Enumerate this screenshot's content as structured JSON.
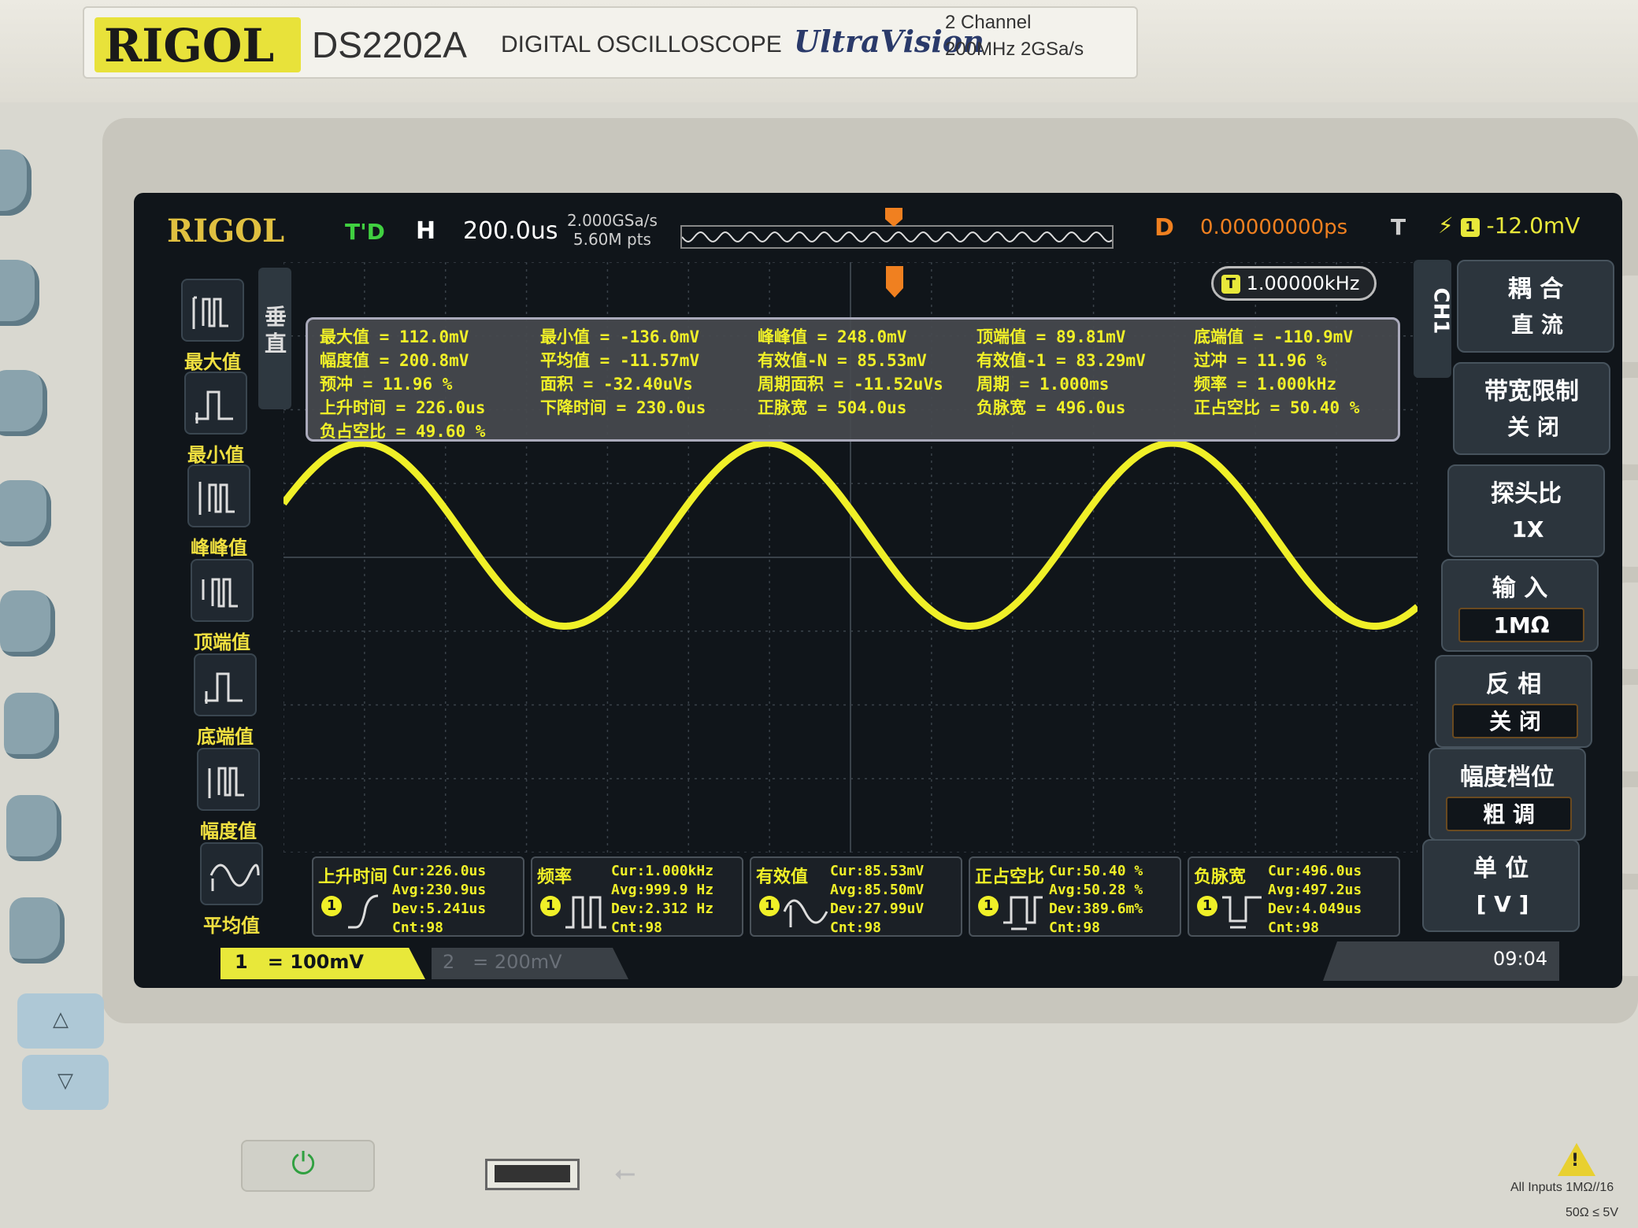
{
  "device": {
    "brand": "RIGOL",
    "model": "DS2202A",
    "description": "DIGITAL OSCILLOSCOPE",
    "series": "UltraVision",
    "channels": "2 Channel",
    "spec": "200MHz  2GSa/s"
  },
  "topbar": {
    "logo": "RIGOL",
    "mode": "T'D",
    "h_label": "H",
    "timebase": "200.0us",
    "sample_rate": "2.000GSa/s",
    "memory": "5.60M pts",
    "d_label": "D",
    "delay": "0.00000000ps",
    "t_label": "T",
    "trigger_source": "1",
    "trigger_level": "-12.0mV",
    "colors": {
      "delay": "#f08020",
      "trigger": "#e8e83a",
      "mode": "#40d040"
    }
  },
  "freq_counter": {
    "value": "1.00000kHz",
    "badge": "T"
  },
  "measurements": [
    {
      "label": "最大值",
      "value": "= 112.0mV"
    },
    {
      "label": "最小值",
      "value": "= -136.0mV"
    },
    {
      "label": "峰峰值",
      "value": "= 248.0mV"
    },
    {
      "label": "顶端值",
      "value": "= 89.81mV"
    },
    {
      "label": "底端值",
      "value": "= -110.9mV"
    },
    {
      "label": "幅度值",
      "value": "= 200.8mV"
    },
    {
      "label": "平均值",
      "value": "= -11.57mV"
    },
    {
      "label": "有效值-N",
      "value": "= 85.53mV"
    },
    {
      "label": "有效值-1",
      "value": "= 83.29mV"
    },
    {
      "label": "过冲",
      "value": "= 11.96 %"
    },
    {
      "label": "预冲",
      "value": "= 11.96 %"
    },
    {
      "label": "面积",
      "value": "= -32.40uVs"
    },
    {
      "label": "周期面积",
      "value": "= -11.52uVs"
    },
    {
      "label": "周期",
      "value": "= 1.000ms"
    },
    {
      "label": "频率",
      "value": "= 1.000kHz"
    },
    {
      "label": "上升时间",
      "value": "= 226.0us"
    },
    {
      "label": "下降时间",
      "value": "= 230.0us"
    },
    {
      "label": "正脉宽",
      "value": "= 504.0us"
    },
    {
      "label": "负脉宽",
      "value": "= 496.0us"
    },
    {
      "label": "正占空比",
      "value": "= 50.40 %"
    },
    {
      "label": "负占空比",
      "value": "= 49.60 %"
    }
  ],
  "left_menu": {
    "tab": "垂直",
    "items": [
      {
        "label": "最大值",
        "icon": "pulse-max-icon"
      },
      {
        "label": "最小值",
        "icon": "pulse-min-icon"
      },
      {
        "label": "峰峰值",
        "icon": "pulse-vpp-icon"
      },
      {
        "label": "顶端值",
        "icon": "pulse-top-icon"
      },
      {
        "label": "底端值",
        "icon": "pulse-base-icon"
      },
      {
        "label": "幅度值",
        "icon": "pulse-amp-icon"
      },
      {
        "label": "平均值",
        "icon": "sine-avg-icon"
      }
    ]
  },
  "right_menu": {
    "tab": "CH1",
    "items": [
      {
        "title": "耦  合",
        "value": "直  流"
      },
      {
        "title": "带宽限制",
        "value": "关  闭"
      },
      {
        "title": "探头比",
        "value": "1X"
      },
      {
        "title": "输  入",
        "value": "1MΩ"
      },
      {
        "title": "反  相",
        "value": "关  闭"
      },
      {
        "title": "幅度档位",
        "value": "粗  调"
      },
      {
        "title": "单  位",
        "value": "[ V ]"
      }
    ]
  },
  "stats": [
    {
      "name": "上升时间",
      "cur": "Cur:226.0us",
      "avg": "Avg:230.9us",
      "dev": "Dev:5.241us",
      "cnt": "Cnt:98",
      "icon": "rise-time-icon"
    },
    {
      "name": "频率",
      "cur": "Cur:1.000kHz",
      "avg": "Avg:999.9 Hz",
      "dev": "Dev:2.312 Hz",
      "cnt": "Cnt:98",
      "icon": "frequency-icon"
    },
    {
      "name": "有效值",
      "cur": "Cur:85.53mV",
      "avg": "Avg:85.50mV",
      "dev": "Dev:27.99uV",
      "cnt": "Cnt:98",
      "icon": "rms-icon"
    },
    {
      "name": "正占空比",
      "cur": "Cur:50.40 %",
      "avg": "Avg:50.28 %",
      "dev": "Dev:389.6m%",
      "cnt": "Cnt:98",
      "icon": "pos-duty-icon"
    },
    {
      "name": "负脉宽",
      "cur": "Cur:496.0us",
      "avg": "Avg:497.2us",
      "dev": "Dev:4.049us",
      "cnt": "Cnt:98",
      "icon": "neg-width-icon"
    }
  ],
  "status_bar": {
    "ch1_num": "1",
    "ch1_scale": "=  100mV",
    "ch2_num": "2",
    "ch2_scale": "=  200mV",
    "time": "09:04"
  },
  "panel": {
    "warning": "All Inputs 1MΩ//16",
    "warning2": "50Ω ≤ 5V"
  },
  "waveform": {
    "color": "#f0f028",
    "period_divisions": 5,
    "amplitude_mv": 124,
    "offset_mv": -12,
    "volts_per_div_mv": 100,
    "grid_color": "#3a424a"
  }
}
